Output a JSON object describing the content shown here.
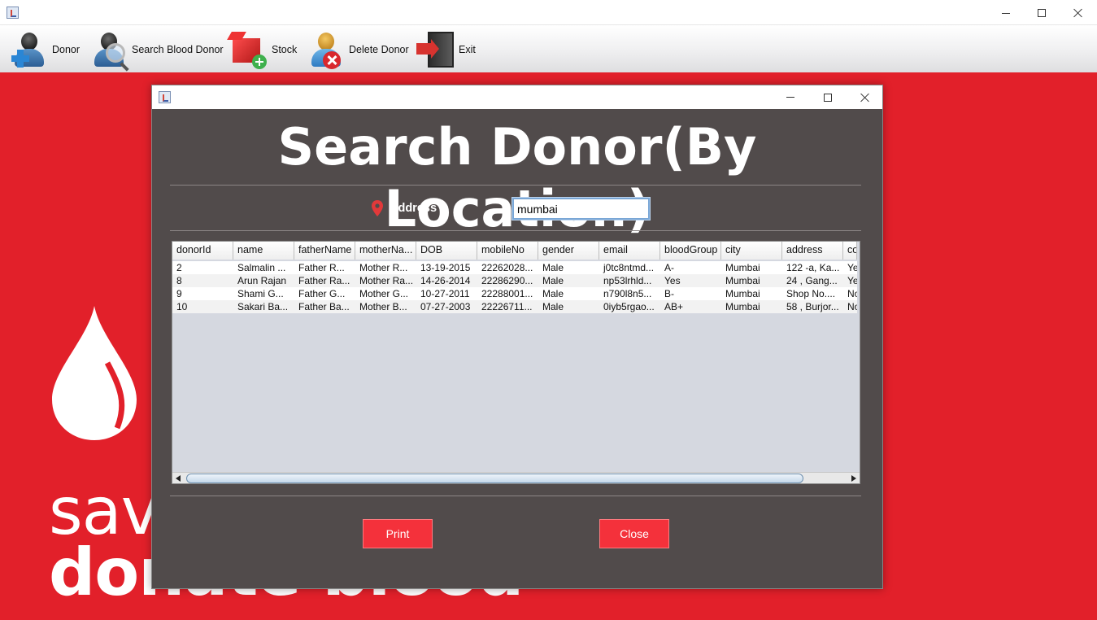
{
  "toolbar": {
    "items": [
      {
        "label": "Donor"
      },
      {
        "label": "Search Blood Donor"
      },
      {
        "label": "Stock"
      },
      {
        "label": "Delete Donor"
      },
      {
        "label": "Exit"
      }
    ]
  },
  "background": {
    "slogan_line1": "save",
    "slogan_line2": "donate blood"
  },
  "dialog": {
    "heading": "Search Donor(By Location)",
    "address_label": "Address",
    "address_value": "mumbai",
    "table": {
      "columns": [
        "donorId",
        "name",
        "fatherName",
        "motherNa...",
        "DOB",
        "mobileNo",
        "gender",
        "email",
        "bloodGroup",
        "city",
        "address",
        "co"
      ],
      "rows": [
        [
          "2",
          "Salmalin ...",
          "Father R...",
          "Mother R...",
          "13-19-2015",
          "22262028...",
          "Male",
          "j0tc8ntmd...",
          "A-",
          "Mumbai",
          "122 -a, Ka...",
          "Ye"
        ],
        [
          "8",
          "Arun  Rajan",
          "Father Ra...",
          "Mother Ra...",
          "14-26-2014",
          "22286290...",
          "Male",
          "np53lrhld...",
          "Yes",
          "Mumbai",
          "24 , Gang...",
          "Ye"
        ],
        [
          "9",
          "Shami  G...",
          "Father  G...",
          "Mother  G...",
          "10-27-2011",
          "22288001...",
          "Male",
          "n790l8n5...",
          "B-",
          "Mumbai",
          "Shop No....",
          "No"
        ],
        [
          "10",
          "Sakari  Ba...",
          "Father  Ba...",
          "Mother  B...",
          "07-27-2003",
          "22226711...",
          "Male",
          "0iyb5rgao...",
          "AB+",
          "Mumbai",
          "58 , Burjor...",
          "No"
        ]
      ]
    },
    "print_label": "Print",
    "close_label": "Close"
  },
  "colors": {
    "brand_red": "#e2202a",
    "dialog_bg": "#514b4b",
    "button_red": "#f4313b"
  },
  "icons": [
    "app-icon",
    "donor-icon",
    "search-donor-icon",
    "stock-icon",
    "delete-donor-icon",
    "exit-icon",
    "location-pin-icon",
    "blood-drop-icon"
  ]
}
